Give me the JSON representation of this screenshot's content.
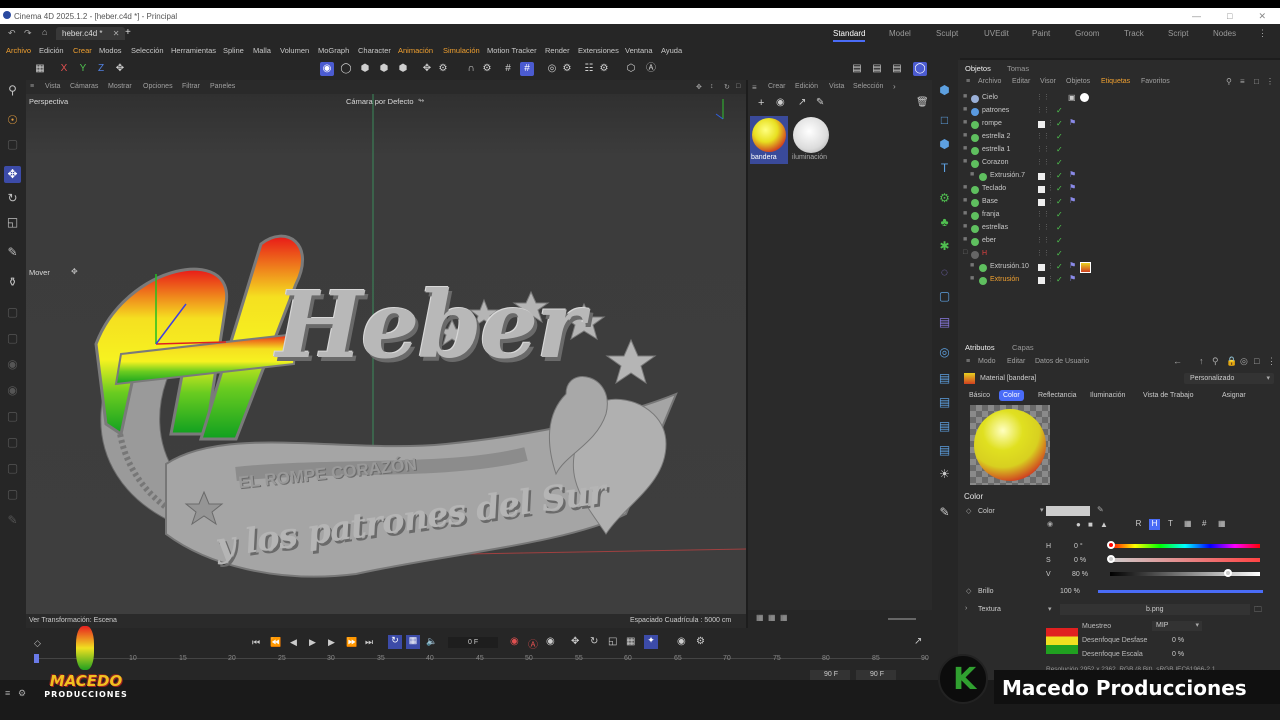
{
  "window": {
    "title": "Cinema 4D 2025.1.2 - [heber.c4d *] - Principal",
    "doc_tab": "heber.c4d *"
  },
  "layouts": [
    "Standard",
    "Model",
    "Sculpt",
    "UVEdit",
    "Paint",
    "Groom",
    "Track",
    "Script",
    "Nodes"
  ],
  "menus": [
    "Archivo",
    "Edición",
    "Crear",
    "Modos",
    "Selección",
    "Herramientas",
    "Spline",
    "Malla",
    "Volumen",
    "MoGraph",
    "Character",
    "Animación",
    "Simulación",
    "Motion Tracker",
    "Render",
    "Extensiones",
    "Ventana",
    "Ayuda"
  ],
  "toolbar": {
    "axes": [
      "X",
      "Y",
      "Z"
    ]
  },
  "viewport": {
    "menu": [
      "Vista",
      "Cámaras",
      "Mostrar",
      "Opciones",
      "Filtrar",
      "Paneles"
    ],
    "label": "Perspectiva",
    "camera": "Cámara por Defecto",
    "tool": "Mover",
    "status_left": "Ver Transformación: Escena",
    "status_right": "Espaciado Cuadrícula : 5000 cm",
    "text_main": "Heber",
    "text_line1": "EL ROMPE CORAZÓN",
    "text_line2": "y los patrones del Sur"
  },
  "materials": {
    "menu": [
      "Crear",
      "Edición",
      "Vista",
      "Selección"
    ],
    "items": [
      "bandera",
      "iluminación"
    ]
  },
  "objects": {
    "tabs": [
      "Objetos",
      "Tomas"
    ],
    "menu": [
      "Archivo",
      "Editar",
      "Visor",
      "Objetos",
      "Etiquetas",
      "Favoritos"
    ],
    "rows": [
      {
        "name": "Cielo",
        "level": 0
      },
      {
        "name": "patrones",
        "level": 0
      },
      {
        "name": "rompe",
        "level": 0
      },
      {
        "name": "estrella 2",
        "level": 0
      },
      {
        "name": "estrella 1",
        "level": 0
      },
      {
        "name": "Corazon",
        "level": 0
      },
      {
        "name": "Extrusión.7",
        "level": 1
      },
      {
        "name": "Teclado",
        "level": 0
      },
      {
        "name": "Base",
        "level": 0
      },
      {
        "name": "franja",
        "level": 0
      },
      {
        "name": "estrellas",
        "level": 0
      },
      {
        "name": "eber",
        "level": 0
      },
      {
        "name": "H",
        "level": 0
      },
      {
        "name": "Extrusión.10",
        "level": 1
      },
      {
        "name": "Extrusión",
        "level": 1
      }
    ]
  },
  "attributes": {
    "tabs": [
      "Atributos",
      "Capas"
    ],
    "menu": [
      "Modo",
      "Editar",
      "Datos de Usuario"
    ],
    "material_label": "Material [bandera]",
    "preset": "Personalizado",
    "subtabs": [
      "Básico",
      "Color",
      "Reflectancia",
      "Iluminación",
      "Vista de Trabajo",
      "Asignar"
    ],
    "section": "Color",
    "color_label": "Color",
    "mode_buttons": [
      "R",
      "H",
      "T"
    ],
    "h_label": "H",
    "h_value": "0 °",
    "s_label": "S",
    "s_value": "0 %",
    "v_label": "V",
    "v_value": "80 %",
    "brillo_label": "Brillo",
    "brillo_value": "100 %",
    "textura_label": "Textura",
    "textura_value": "b.png",
    "muestreo_label": "Muestreo",
    "muestreo_value": "MIP",
    "desenfoque_desfase_label": "Desenfoque Desfase",
    "desenfoque_desfase_value": "0 %",
    "desenfoque_escala_label": "Desenfoque Escala",
    "desenfoque_escala_value": "0 %",
    "resolution": "Resolución 2952 x 2362, RGB (8 Bit), sRGB IEC61966-2.1"
  },
  "timeline": {
    "frame_field": "0 F",
    "end1": "90 F",
    "end2": "90 F",
    "ticks": [
      "10",
      "15",
      "20",
      "25",
      "30",
      "35",
      "40",
      "45",
      "50",
      "55",
      "60",
      "65",
      "70",
      "75",
      "80",
      "85",
      "90"
    ]
  },
  "watermark": {
    "logo_text": "MACEDO",
    "logo_sub": "PRODUCCIONES",
    "brand": "Macedo Producciones"
  },
  "colors": {
    "accent": "#4a6cf7",
    "orange": "#f0a030",
    "green": "#4fc84f"
  }
}
